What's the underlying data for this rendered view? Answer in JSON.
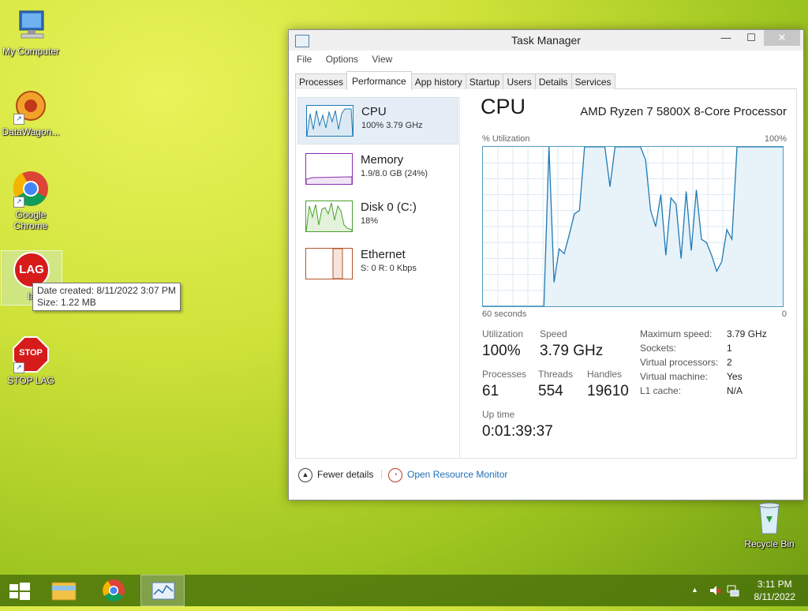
{
  "desktop": {
    "icons": [
      {
        "label": "My Computer"
      },
      {
        "label": "DataWagon..."
      },
      {
        "label": "Google Chrome"
      },
      {
        "label": "la"
      },
      {
        "label": "STOP LAG"
      },
      {
        "label": "Recycle Bin"
      }
    ],
    "lag_badge": "LAG",
    "stop_badge": "STOP",
    "tooltip": {
      "line1": "Date created: 8/11/2022 3:07 PM",
      "line2": "Size: 1.22 MB"
    }
  },
  "window": {
    "title": "Task Manager",
    "controls": {
      "minimize": "—",
      "maximize": "☐",
      "close": "✕"
    },
    "menu": [
      "File",
      "Options",
      "View"
    ],
    "tabs": [
      "Processes",
      "Performance",
      "App history",
      "Startup",
      "Users",
      "Details",
      "Services"
    ],
    "active_tab": "Performance",
    "sidebar": [
      {
        "name": "CPU",
        "value": "100%  3.79 GHz",
        "color": "#1e7ab5"
      },
      {
        "name": "Memory",
        "value": "1.9/8.0 GB (24%)",
        "color": "#8a2fb0"
      },
      {
        "name": "Disk 0 (C:)",
        "value": "18%",
        "color": "#4aa02c"
      },
      {
        "name": "Ethernet",
        "value": "S: 0  R: 0 Kbps",
        "color": "#b0562a"
      }
    ],
    "detail": {
      "title": "CPU",
      "processor": "AMD Ryzen 7 5800X 8-Core Processor",
      "graph_label": "% Utilization",
      "graph_max": "100%",
      "graph_left": "60 seconds",
      "graph_right": "0",
      "utilization_series": [
        0,
        0,
        0,
        0,
        0,
        0,
        0,
        0,
        0,
        0,
        0,
        0,
        0,
        100,
        15,
        36,
        33,
        45,
        58,
        60,
        100,
        100,
        100,
        100,
        100,
        75,
        100,
        100,
        100,
        100,
        100,
        100,
        92,
        60,
        50,
        70,
        32,
        68,
        64,
        30,
        72,
        35,
        73,
        42,
        40,
        32,
        22,
        28,
        48,
        42,
        100,
        100,
        100,
        100,
        100,
        100,
        100,
        100,
        100,
        100
      ],
      "stats": {
        "utilization_label": "Utilization",
        "utilization": "100%",
        "speed_label": "Speed",
        "speed": "3.79 GHz",
        "processes_label": "Processes",
        "processes": "61",
        "threads_label": "Threads",
        "threads": "554",
        "handles_label": "Handles",
        "handles": "19610",
        "uptime_label": "Up time",
        "uptime": "0:01:39:37"
      },
      "specs": [
        {
          "label": "Maximum speed:",
          "value": "3.79 GHz"
        },
        {
          "label": "Sockets:",
          "value": "1"
        },
        {
          "label": "Virtual processors:",
          "value": "2"
        },
        {
          "label": "Virtual machine:",
          "value": "Yes"
        },
        {
          "label": "L1 cache:",
          "value": "N/A"
        }
      ]
    },
    "footer": {
      "fewer_details": "Fewer details",
      "resource_monitor": "Open Resource Monitor"
    }
  },
  "taskbar": {
    "time": "3:11 PM",
    "date": "8/11/2022",
    "tray_arrow": "▲"
  },
  "colors": {
    "cpu_line": "#1e7ab5",
    "cpu_fill": "#e8f2f9"
  }
}
